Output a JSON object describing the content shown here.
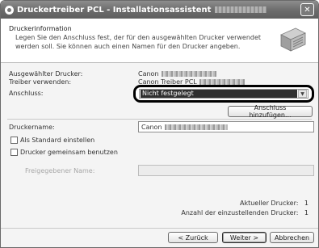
{
  "window": {
    "title": "Druckertreiber PCL - Installationsassistent",
    "close_glyph": "✕"
  },
  "header": {
    "title": "Druckerinformation",
    "description": "Legen Sie den Anschluss fest, der für den ausgewählten Drucker verwendet werden soll. Sie können auch einen Namen für den Drucker angeben."
  },
  "info": {
    "selected_printer_label": "Ausgewählter Drucker:",
    "selected_printer_value": "Canon",
    "driver_label": "Treiber verwenden:",
    "driver_value": "Canon Treiber PCL",
    "port_label": "Anschluss:"
  },
  "port_select": {
    "selected": "Nicht festgelegt",
    "arrow_glyph": "▼"
  },
  "add_port_button": "Anschluss hinzufügen...",
  "printer_name": {
    "label": "Druckername:",
    "value": "Canon"
  },
  "options": {
    "set_default_label": "Als Standard einstellen",
    "share_label": "Drucker gemeinsam benutzen",
    "share_name_label": "Freigegebener Name:"
  },
  "status": {
    "current_label": "Aktueller Drucker:",
    "current_value": "1",
    "count_label": "Anzahl der einzustellenden Drucker:",
    "count_value": "1"
  },
  "buttons": {
    "back": "< Zurück",
    "next": "Weiter >",
    "cancel": "Abbrechen"
  }
}
